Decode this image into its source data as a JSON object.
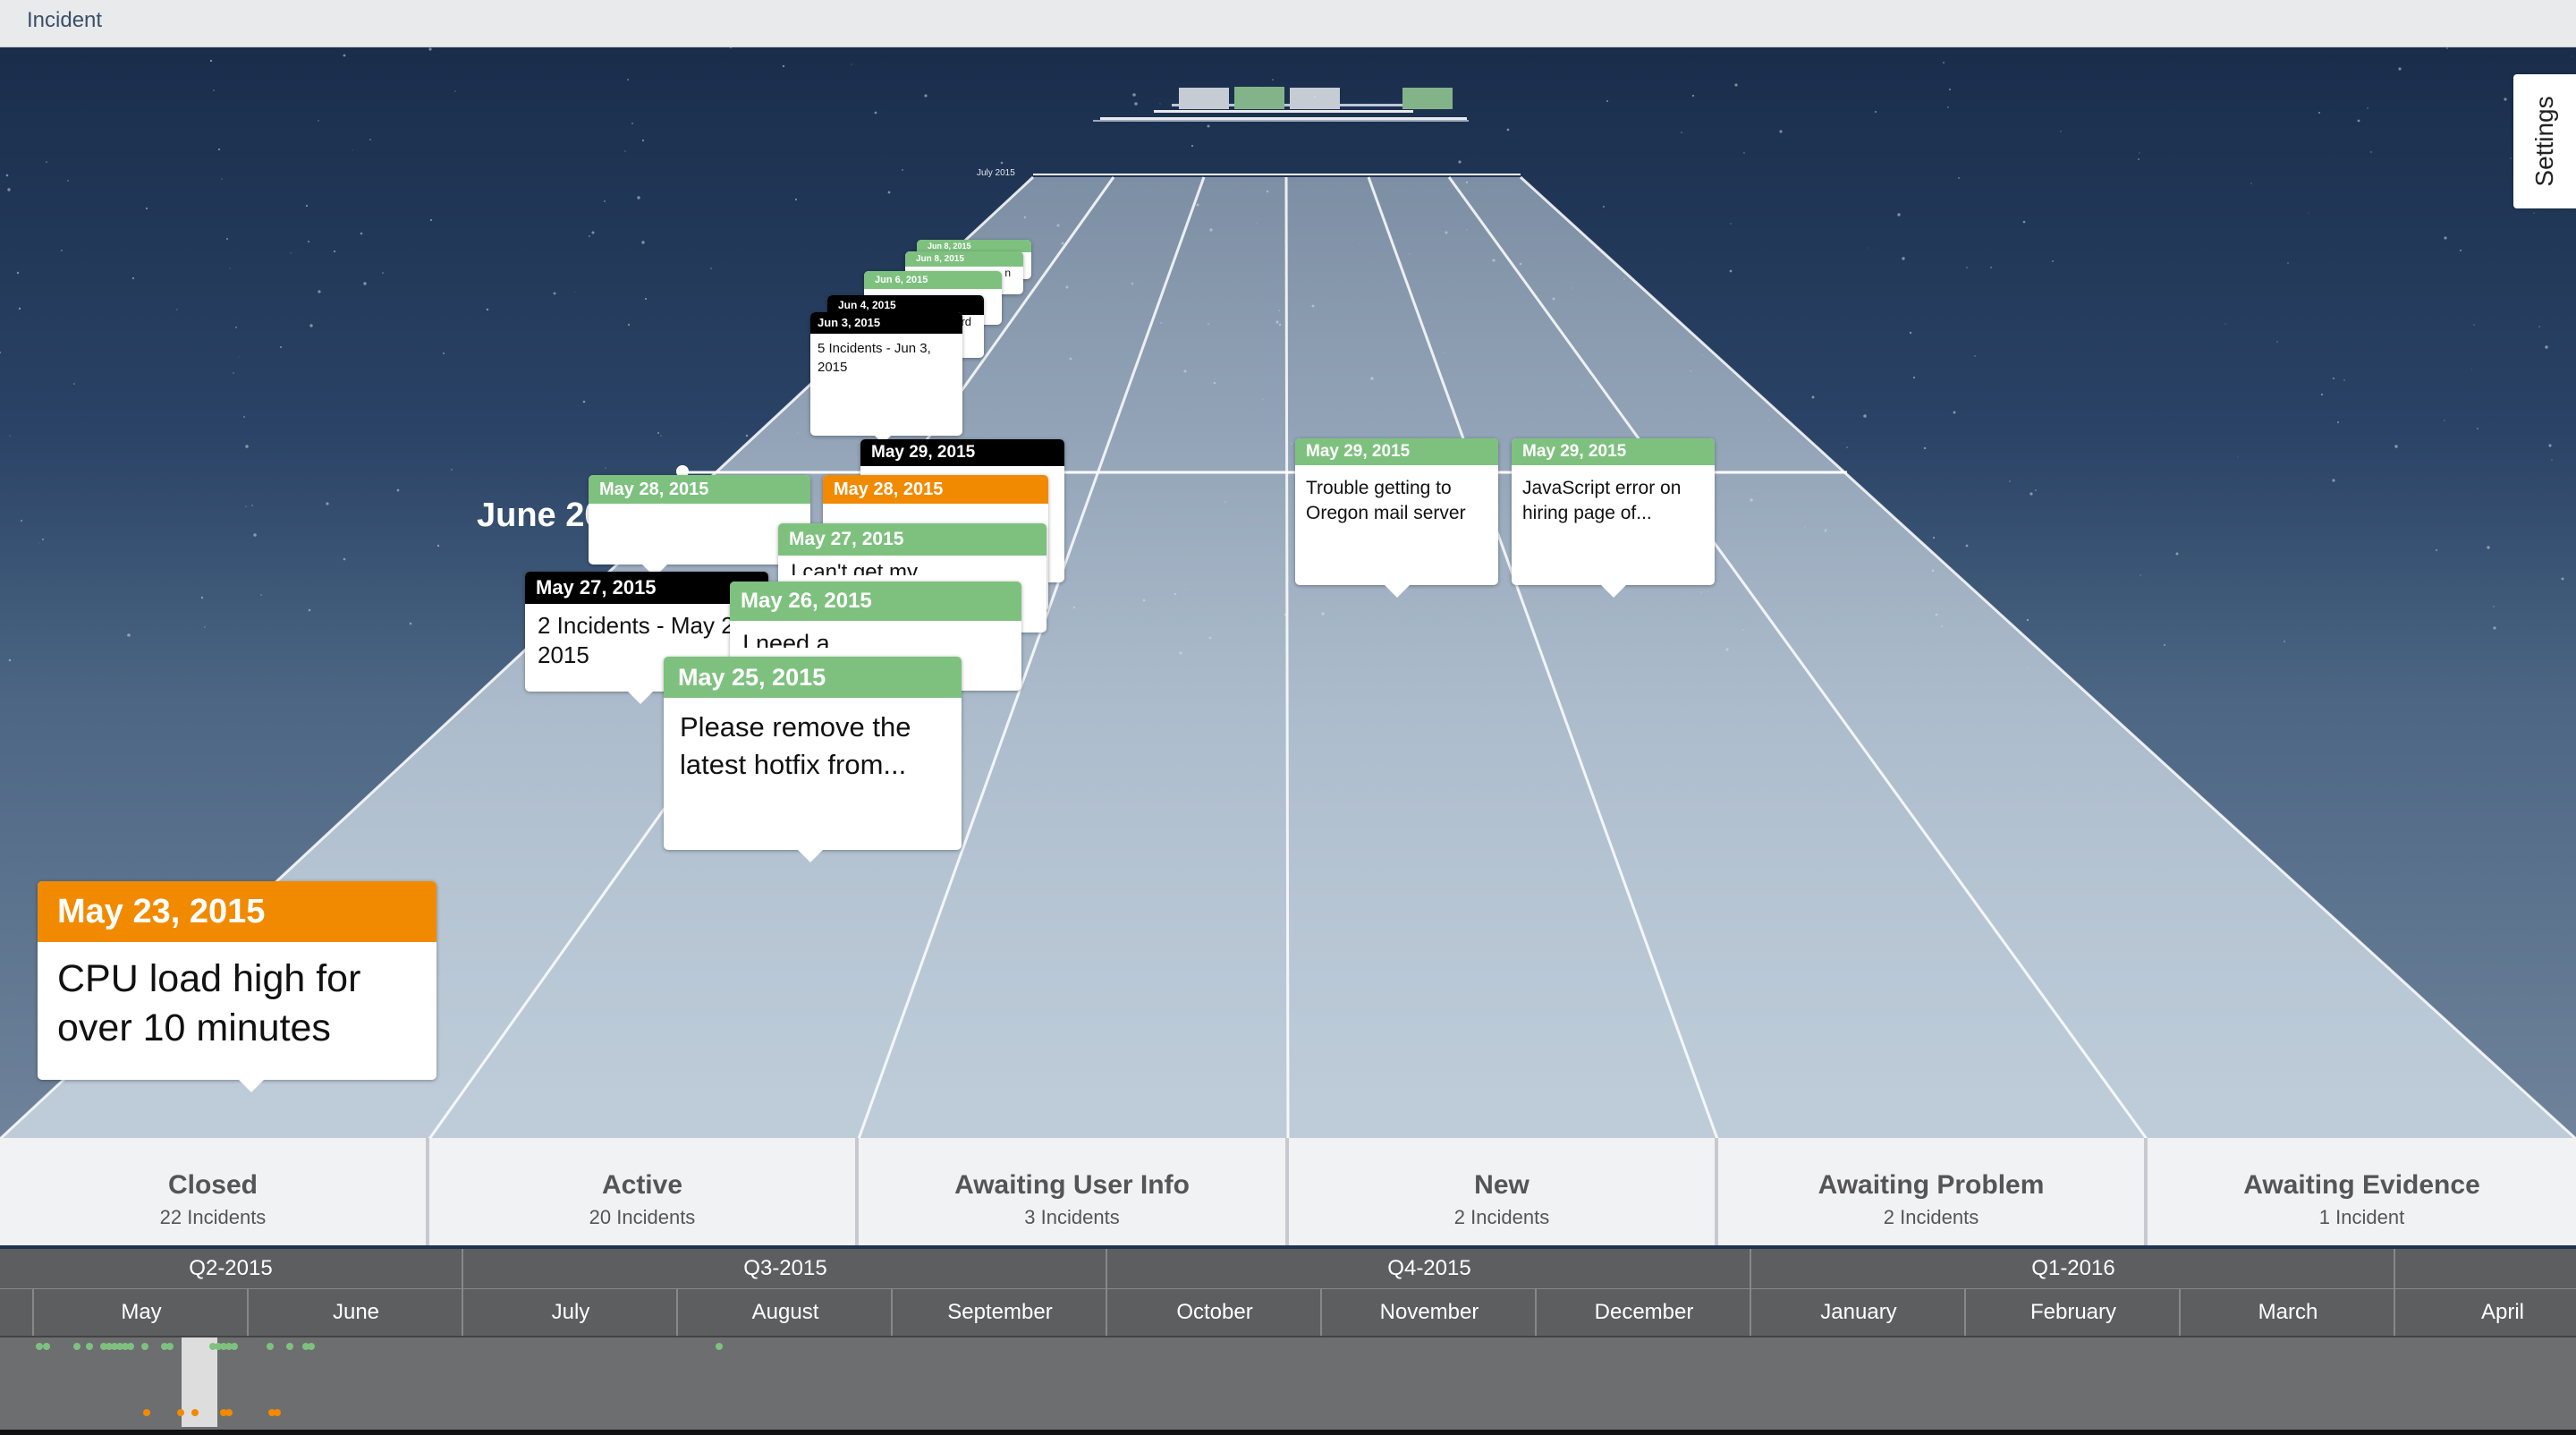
{
  "app": {
    "title": "Incident"
  },
  "settings": {
    "label": "Settings"
  },
  "scene": {
    "month_label": "June 2015",
    "far_month_label": "July 2015"
  },
  "cards": [
    {
      "date": "Jun 8, 2015",
      "text": "",
      "color": "green"
    },
    {
      "date": "Jun 8, 2015",
      "text": "n",
      "color": "green"
    },
    {
      "date": "Jun 6, 2015",
      "text": "",
      "color": "green"
    },
    {
      "date": "Jun 4, 2015",
      "text": "rd",
      "color": "black"
    },
    {
      "date": "Jun 3, 2015",
      "text": "5 Incidents - Jun 3, 2015",
      "color": "black"
    },
    {
      "date": "May 29, 2015",
      "text": "",
      "color": "black"
    },
    {
      "date": "May 28, 2015",
      "text": "",
      "color": "green"
    },
    {
      "date": "May 28, 2015",
      "text": "",
      "color": "orange"
    },
    {
      "date": "May 27, 2015",
      "text": "2 Incidents - May 27, 2015",
      "color": "black"
    },
    {
      "date": "May 27, 2015",
      "text": "I can't get my",
      "color": "green"
    },
    {
      "date": "May 26, 2015",
      "text": "I need a",
      "color": "green"
    },
    {
      "date": "May 25, 2015",
      "text": "Please remove the latest hotfix from...",
      "color": "green"
    },
    {
      "date": "May 29, 2015",
      "text": "Trouble getting to Oregon mail server",
      "color": "green"
    },
    {
      "date": "May 29, 2015",
      "text": "JavaScript error on hiring page of...",
      "color": "green"
    },
    {
      "date": "May 23, 2015",
      "text": "CPU load high for over 10 minutes",
      "color": "orange"
    }
  ],
  "lanes": [
    {
      "name": "Closed",
      "count": "22 Incidents"
    },
    {
      "name": "Active",
      "count": "20 Incidents"
    },
    {
      "name": "Awaiting User Info",
      "count": "3 Incidents"
    },
    {
      "name": "New",
      "count": "2 Incidents"
    },
    {
      "name": "Awaiting Problem",
      "count": "2 Incidents"
    },
    {
      "name": "Awaiting Evidence",
      "count": "1 Incident"
    }
  ],
  "timeline": {
    "quarters": [
      "Q2-2015",
      "Q3-2015",
      "Q4-2015",
      "Q1-2016"
    ],
    "months": [
      "May",
      "June",
      "July",
      "August",
      "September",
      "October",
      "November",
      "December",
      "January",
      "February",
      "March",
      "April"
    ]
  },
  "colors": {
    "green": "#7ec17f",
    "orange": "#f28a00",
    "black": "#000000",
    "lane_bg": "#f1f2f4",
    "timeline_bg": "#6d6e70"
  }
}
